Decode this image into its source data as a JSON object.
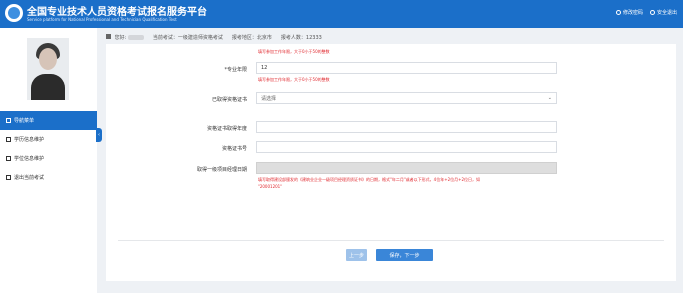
{
  "header": {
    "title": "全国专业技术人员资格考试报名服务平台",
    "subtitle": "Service platform for National Professional and Technician Qualification Test",
    "links": [
      {
        "label": "修改密码",
        "icon": "gear-icon"
      },
      {
        "label": "安全退出",
        "icon": "logout-icon"
      }
    ]
  },
  "sidebar": {
    "items": [
      {
        "label": "导航菜单",
        "icon": "home-icon"
      },
      {
        "label": "学历信息维护",
        "icon": "education-icon"
      },
      {
        "label": "学位信息维护",
        "icon": "degree-icon"
      },
      {
        "label": "退出当前考试",
        "icon": "exit-icon"
      }
    ]
  },
  "info_bar": {
    "user_prefix": "您好:",
    "exam": "当前考试：一级建造师资格考试",
    "region": "报考地区：北京市",
    "count": "报考人数：12333"
  },
  "form": {
    "hint_top": "填写参加工作年限，大于0小于50的整数",
    "major_years": {
      "label": "*专业年限",
      "value": "12",
      "hint": "填写参加工作年限，大于0小于50的整数"
    },
    "obtained_cert": {
      "label": "已取得资格证书",
      "value": "请选择"
    },
    "cert_year": {
      "label": "资格证书取得年度",
      "value": ""
    },
    "cert_no": {
      "label": "资格证书号",
      "value": ""
    },
    "first_date": {
      "label": "取得一级项目经理日期",
      "value": "",
      "hint_line1": "填写取得建设部颁发的《建筑业企业一级项目经理资质证书》的日期，格式\"年二月\"或者以下形式，4位年+2位月+2位日，如",
      "hint_line2": "\"20001201\""
    }
  },
  "buttons": {
    "prev": "上一步",
    "next": "保存，下一步"
  },
  "colors": {
    "primary": "#1b6fc9",
    "error": "#e0282e"
  }
}
